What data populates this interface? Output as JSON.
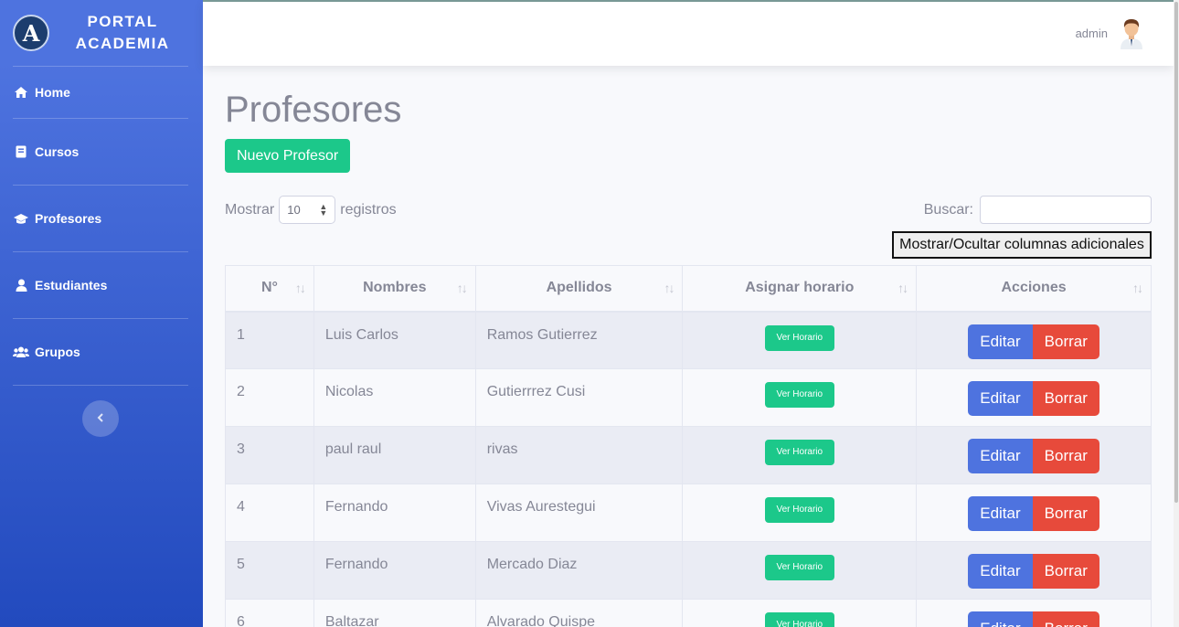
{
  "brand": {
    "logo_letter": "A",
    "line1": "PORTAL",
    "line2": "ACADEMIA"
  },
  "sidebar": {
    "items": [
      {
        "label": "Home",
        "icon": "home-icon"
      },
      {
        "label": "Cursos",
        "icon": "book-icon"
      },
      {
        "label": "Profesores",
        "icon": "graduation-cap-icon"
      },
      {
        "label": "Estudiantes",
        "icon": "user-icon"
      },
      {
        "label": "Grupos",
        "icon": "users-icon"
      }
    ],
    "toggle_icon": "chevron-left-icon"
  },
  "topbar": {
    "user_name": "admin",
    "avatar_icon": "user-avatar"
  },
  "main": {
    "title": "Profesores",
    "new_button": "Nuevo Profesor",
    "length_prefix": "Mostrar",
    "length_value": "10",
    "length_suffix": "registros",
    "search_label": "Buscar:",
    "search_value": "",
    "column_toggle": "Mostrar/Ocultar columnas adicionales"
  },
  "table": {
    "headers": [
      "N°",
      "Nombres",
      "Apellidos",
      "Asignar horario",
      "Acciones"
    ],
    "schedule_button": "Ver Horario",
    "edit_button": "Editar",
    "delete_button": "Borrar",
    "rows": [
      {
        "num": "1",
        "nombres": "Luis Carlos",
        "apellidos": "Ramos Gutierrez"
      },
      {
        "num": "2",
        "nombres": "Nicolas",
        "apellidos": "Gutierrrez Cusi"
      },
      {
        "num": "3",
        "nombres": "paul raul",
        "apellidos": "rivas"
      },
      {
        "num": "4",
        "nombres": "Fernando",
        "apellidos": "Vivas Aurestegui"
      },
      {
        "num": "5",
        "nombres": "Fernando",
        "apellidos": "Mercado Diaz"
      },
      {
        "num": "6",
        "nombres": "Baltazar",
        "apellidos": "Alvarado Quispe"
      }
    ]
  },
  "colors": {
    "primary": "#4e73df",
    "success": "#1cc88a",
    "danger": "#e74a3b",
    "text": "#858796"
  }
}
